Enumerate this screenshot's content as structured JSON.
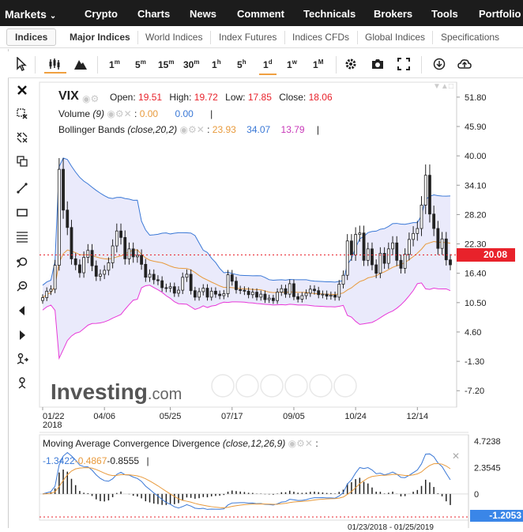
{
  "topnav": {
    "items": [
      "Markets",
      "Crypto",
      "Charts",
      "News",
      "Comment",
      "Technicals",
      "Brokers",
      "Tools",
      "Portfolio"
    ],
    "markets_arrow": "chevron-down-icon"
  },
  "subnav": {
    "tabs": [
      "Indices",
      "Major Indices",
      "World Indices",
      "Index Futures",
      "Indices CFDs",
      "Global Indices",
      "Specifications"
    ],
    "active": "Indices"
  },
  "toolbar": {
    "timeframes": [
      "1m",
      "5m",
      "15m",
      "30m",
      "1h",
      "5h",
      "1d",
      "1w",
      "1M"
    ],
    "active_timeframe": "1d",
    "icons": [
      "cursor-icon",
      "candlestick-icon",
      "mountain-icon",
      "gear-icon",
      "camera-icon",
      "fullscreen-icon",
      "download-icon",
      "upload-icon"
    ]
  },
  "left_tools": [
    "close-icon",
    "remove-drawing-icon",
    "magnet-icon",
    "clone-icon",
    "trendline-icon",
    "rectangle-icon",
    "fibonacci-icon",
    "zoom-in-icon",
    "zoom-out-icon",
    "scroll-left-icon",
    "scroll-right-icon",
    "scale-icon",
    "reset-icon"
  ],
  "legend": {
    "symbol": "VIX",
    "open_label": "Open:",
    "open": "19.51",
    "high_label": "High:",
    "high": "19.72",
    "low_label": "Low:",
    "low": "17.85",
    "close_label": "Close:",
    "close": "18.06",
    "volume_label": "Volume",
    "volume_param": "(9)",
    "volume_v1": "0.00",
    "volume_v2": "0.00",
    "volume_tail": "|",
    "bb_label": "Bollinger Bands",
    "bb_param": "(close,20,2)",
    "bb_mid": "23.93",
    "bb_upper": "34.07",
    "bb_lower": "13.79",
    "bb_tail": "|",
    "macd_label": "Moving Average Convergence Divergence",
    "macd_param": "(close,12,26,9)",
    "macd_v1": "-1.3422",
    "macd_v2": "-0.4867",
    "macd_v3": "-0.8555",
    "macd_tail": "|",
    "colon": ":"
  },
  "last_price": "20.08",
  "macd_last": "-1.2053",
  "watermark": {
    "main": "Investing",
    "suffix": ".com"
  },
  "date_readout": "01/23/2018 - 01/25/2019",
  "chart_data": {
    "type": "candlestick",
    "symbol": "VIX",
    "price_axis": [
      51.8,
      45.9,
      40.0,
      34.1,
      28.2,
      22.3,
      16.4,
      10.5,
      4.6,
      -1.3,
      -7.2
    ],
    "x_ticks": [
      "01/22",
      "04/06",
      "05/25",
      "07/17",
      "09/05",
      "10/24",
      "12/14"
    ],
    "x_year": "2018",
    "ylim": [
      -10.5,
      54.8
    ],
    "macd_axis": [
      4.7238,
      2.3545,
      0
    ],
    "colors": {
      "candle_up": "#222222",
      "candle_down": "#222222",
      "bb_upper": "#3a78d6",
      "bb_lower": "#e838d8",
      "bb_mid": "#e89a3c",
      "bb_fill": "#e6e6fa",
      "macd_line": "#3a78d6",
      "signal_line": "#e89a3c",
      "price_line": "#e8222b"
    },
    "closes": [
      11.5,
      12.8,
      13.2,
      18.0,
      37.3,
      29.1,
      25.6,
      19.3,
      18.1,
      16.5,
      19.6,
      21.0,
      17.9,
      15.8,
      16.2,
      17.0,
      18.5,
      21.9,
      24.9,
      23.6,
      19.3,
      21.3,
      19.7,
      20.0,
      18.2,
      15.6,
      16.2,
      15.1,
      14.9,
      13.5,
      13.4,
      13.7,
      12.4,
      13.0,
      15.6,
      16.2,
      12.9,
      11.6,
      12.7,
      13.4,
      11.6,
      12.8,
      12.2,
      11.9,
      12.3,
      16.1,
      14.8,
      13.1,
      13.0,
      12.8,
      12.1,
      12.6,
      11.6,
      12.2,
      11.1,
      11.4,
      10.9,
      12.6,
      13.3,
      12.2,
      14.3,
      11.7,
      11.2,
      11.9,
      12.4,
      13.2,
      12.9,
      12.1,
      12.2,
      11.8,
      12.0,
      11.6,
      14.2,
      16.0,
      22.9,
      20.1,
      24.2,
      24.5,
      19.0,
      21.3,
      18.1,
      16.4,
      20.4,
      18.4,
      21.3,
      22.5,
      19.0,
      17.4,
      20.2,
      23.2,
      24.4,
      25.4,
      30.1,
      36.1,
      28.3,
      25.4,
      21.4,
      23.3,
      19.1,
      18.1
    ]
  }
}
